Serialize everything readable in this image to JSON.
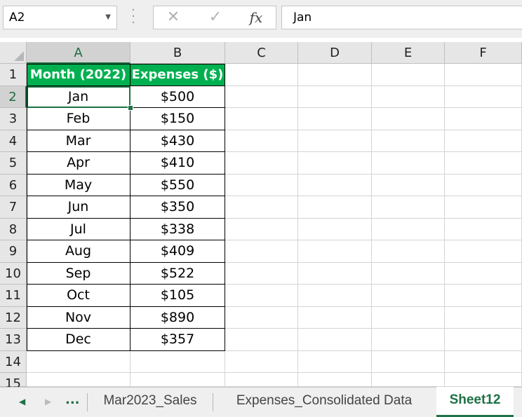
{
  "formula_bar": {
    "name_box": "A2",
    "cancel_symbol": "✕",
    "enter_symbol": "✓",
    "fx_label": "fx",
    "formula": "Jan"
  },
  "columns": [
    "A",
    "B",
    "C",
    "D",
    "E",
    "F"
  ],
  "rows": [
    "1",
    "2",
    "3",
    "4",
    "5",
    "6",
    "7",
    "8",
    "9",
    "10",
    "11",
    "12",
    "13",
    "14",
    "15"
  ],
  "table": {
    "headers": [
      "Month (2022)",
      "Expenses ($)"
    ],
    "rows": [
      [
        "Jan",
        "$500"
      ],
      [
        "Feb",
        "$150"
      ],
      [
        "Mar",
        "$430"
      ],
      [
        "Apr",
        "$410"
      ],
      [
        "May",
        "$550"
      ],
      [
        "Jun",
        "$350"
      ],
      [
        "Jul",
        "$338"
      ],
      [
        "Aug",
        "$409"
      ],
      [
        "Sep",
        "$522"
      ],
      [
        "Oct",
        "$105"
      ],
      [
        "Nov",
        "$890"
      ],
      [
        "Dec",
        "$357"
      ]
    ]
  },
  "sheet_tabs": {
    "more": "...",
    "tabs": [
      "Mar2023_Sales",
      "Expenses_Consolidated Data",
      "Sheet12"
    ],
    "active": "Sheet12"
  },
  "colors": {
    "header_fill": "#00b050",
    "header_text": "#ffffff",
    "accent": "#1e7145"
  }
}
